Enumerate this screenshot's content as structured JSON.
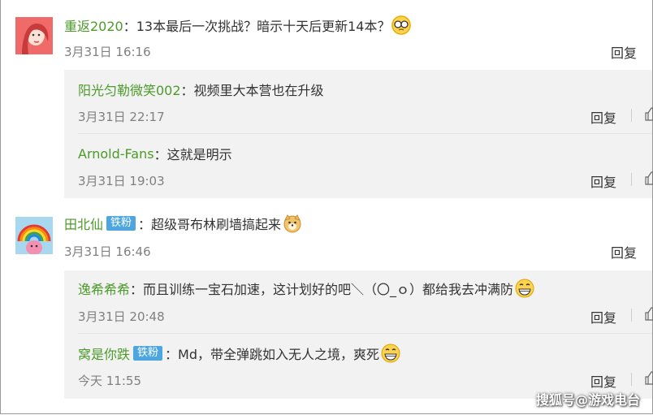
{
  "comments": [
    {
      "user": "重返2020",
      "text": "：13本最后一次挑战？暗示十天后更新14本？",
      "emoji_icon": "glasses-face-icon",
      "time": "3月31日 16:16",
      "reply": "回复",
      "replies": [
        {
          "user": "阳光匀勒微笑002",
          "text": "：视频里大本营也在升级",
          "time": "3月31日 22:17",
          "reply": "回复"
        },
        {
          "user": "Arnold-Fans",
          "text": "：这就是明示",
          "time": "3月31日 19:03",
          "reply": "回复"
        }
      ]
    },
    {
      "user": "田北仙",
      "badge": "铁粉",
      "text": "：超级哥布林刷墙搞起来",
      "emoji_icon": "doge-face-icon",
      "time": "3月31日 16:46",
      "reply": "回复",
      "replies": [
        {
          "user": "逸希希希",
          "text": "：而且训练一宝石加速，这计划好的吧＼（〇_ｏ）都给我去冲满防",
          "emoji_icon": "grin-face-icon",
          "time": "3月31日 20:48",
          "reply": "回复"
        },
        {
          "user": "窝是你跌",
          "badge": "铁粉",
          "text": "：Md，带全弹跳如入无人之境，爽死",
          "emoji_icon": "grin-face-icon",
          "time": "今天 11:55",
          "reply": "回复"
        }
      ]
    }
  ],
  "watermark": "搜狐号@游戏电台"
}
